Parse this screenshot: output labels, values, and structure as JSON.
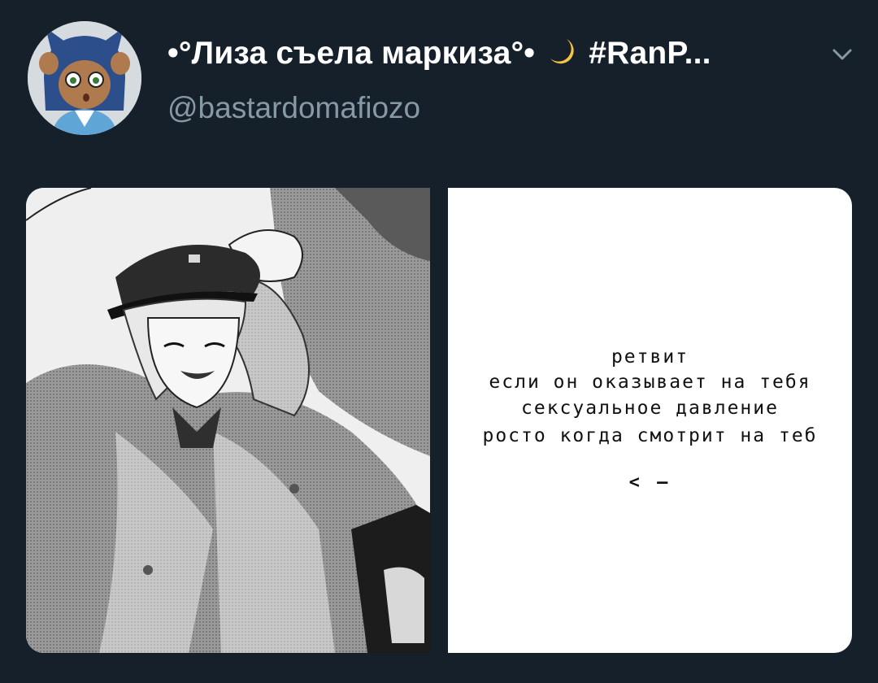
{
  "tweet": {
    "display_name_before": "•°Лиза съела маркиза°•",
    "display_name_after": "#RanP...",
    "handle": "@bastardomafiozo"
  },
  "icons": {
    "avatar": "cartoon-cat-girl-avatar",
    "moon": "crescent-moon-emoji",
    "chevron": "chevron-down-icon"
  },
  "colors": {
    "background": "#15202b",
    "name": "#ffffff",
    "handle": "#8899a6",
    "moon": "#f4c542"
  },
  "media": {
    "left_image": "manga-boy-in-cap-illustration",
    "right_lines": [
      "ретвит",
      "если он оказывает на тебя",
      "сексуальное давление",
      "росто когда смотрит на теб"
    ],
    "right_arrow": "< –"
  }
}
